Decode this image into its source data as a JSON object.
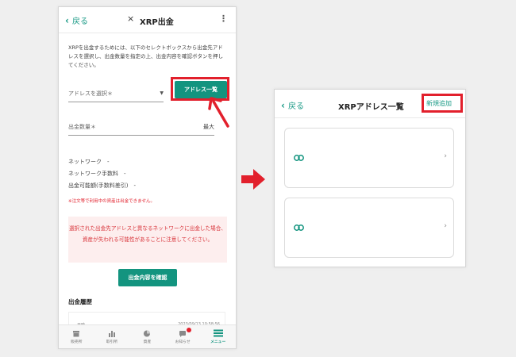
{
  "left_screen": {
    "header": {
      "back_label": "戻る",
      "close_glyph": "×",
      "title": "XRP出金",
      "menu_glyph": "⋮"
    },
    "intro_text": "XRPを出金するためには、以下のセレクトボックスから出金先アドレスを選択し、出金数量を指定の上、出金内容を確認ボタンを押してください。",
    "address_select": {
      "placeholder": "アドレスを選択＊",
      "caret": "▼"
    },
    "address_list_button": "アドレス一覧",
    "quantity": {
      "label": "出金数量＊",
      "max_label": "最大"
    },
    "network_label": "ネットワーク　-",
    "network_fee_label": "ネットワーク手数料　-",
    "withdrawable_label": "出金可能額(手数料差引)　-",
    "order_note": "※注文等で利用中の資産は出金できません。",
    "warning_text": "選択された出金先アドレスと異なるネットワークに出金した場合、資産が失われる可能性があることに注意してください。",
    "confirm_button": "出金内容を確認",
    "history": {
      "title": "出金履歴",
      "date_label": "日時",
      "date_value": "2023/09/13 10:58:56"
    },
    "tabs": [
      {
        "label": "販売所",
        "icon": "shop-icon"
      },
      {
        "label": "取引所",
        "icon": "bar-chart-icon"
      },
      {
        "label": "資産",
        "icon": "pie-chart-icon"
      },
      {
        "label": "お知らせ",
        "icon": "notification-icon"
      },
      {
        "label": "メニュー",
        "icon": "menu-icon"
      }
    ]
  },
  "right_screen": {
    "header": {
      "back_label": "戻る",
      "title": "XRPアドレス一覧",
      "new_button": "新規追加"
    },
    "cards": [
      {
        "icon": "link-icon",
        "chevron": "›"
      },
      {
        "icon": "link-icon",
        "chevron": "›"
      }
    ]
  },
  "colors": {
    "accent": "#13947f",
    "highlight": "#e2202c",
    "warning_bg": "#fdeeee"
  }
}
